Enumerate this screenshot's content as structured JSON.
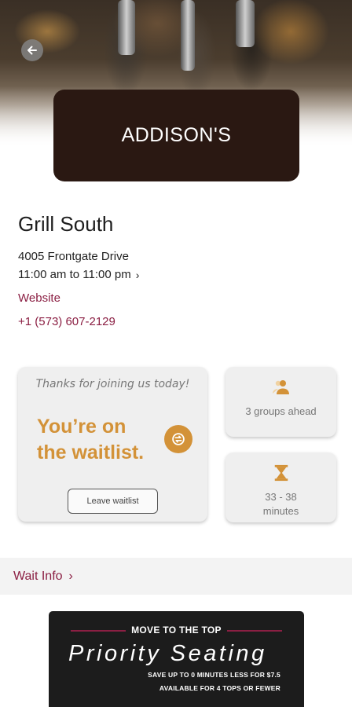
{
  "header": {
    "logo_text": "ADDISON'S"
  },
  "restaurant": {
    "name": "Grill South",
    "address": "4005 Frontgate Drive",
    "hours": "11:00 am to 11:00 pm",
    "website_label": "Website",
    "phone": "+1 (573) 607-2129"
  },
  "waitlist": {
    "thanks": "Thanks for joining us today!",
    "status_line1": "You’re on",
    "status_line2": "the waitlist.",
    "leave_label": "Leave waitlist",
    "groups_ahead": "3 groups ahead",
    "wait_time_line1": "33 - 38",
    "wait_time_line2": "minutes"
  },
  "wait_info": {
    "label": "Wait Info"
  },
  "promo": {
    "heading": "MOVE TO THE TOP",
    "title": "Priority Seating",
    "subline1": "SAVE UP TO 0 MINUTES LESS FOR $7.5",
    "subline2": "AVAILABLE FOR 4 TOPS OR FEWER"
  },
  "colors": {
    "accent": "#8b1f43",
    "waitlist_orange": "#d39238",
    "logo_bg": "#2a1812",
    "promo_bg": "#1c1c1c"
  },
  "icons": [
    "arrow-left-icon",
    "chevron-right-icon",
    "waitlist-refresh-icon",
    "people-icon",
    "hourglass-icon"
  ]
}
